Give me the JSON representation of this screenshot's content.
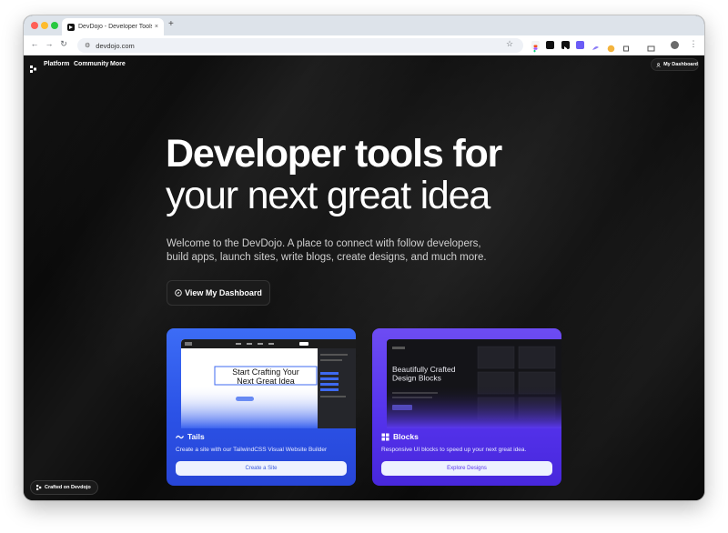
{
  "browser": {
    "tab_title": "DevDojo - Developer Tools for",
    "tab_close": "×",
    "new_tab": "+",
    "url": "devdojo.com",
    "back": "←",
    "forward": "→",
    "reload": "↻",
    "site_info": "⚙",
    "bookmark": "☆",
    "menu": "⋮"
  },
  "site_nav": {
    "links": [
      "Platform",
      "Community",
      "More"
    ],
    "dashboard_button": "My Dashboard"
  },
  "hero": {
    "title_line1": "Developer tools for",
    "title_line2": "your next great idea",
    "subtitle": "Welcome to the DevDojo. A place to connect with follow developers, build apps, launch sites, write blogs, create designs, and much more.",
    "cta_label": "View My Dashboard"
  },
  "cards": {
    "tails": {
      "title": "Tails",
      "preview_heading": "Start Crafting Your Next Great Idea",
      "description": "Create a site with our TailwindCSS Visual Website Builder",
      "button": "Create a Site"
    },
    "blocks": {
      "title": "Blocks",
      "preview_heading": "Beautifully Crafted Design Blocks",
      "description": "Responsive UI blocks to speed up your next great idea.",
      "button": "Explore Designs"
    }
  },
  "footer_badge": "Crafted on Devdojo",
  "colors": {
    "page_bg": "#0b0b0b",
    "tails_card": "#2b52e6",
    "blocks_card": "#5533ec"
  }
}
